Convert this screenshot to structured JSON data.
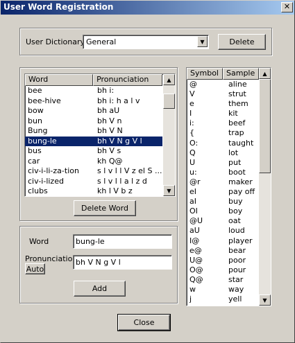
{
  "window": {
    "title": "User Word Registration",
    "close_glyph": "✕"
  },
  "dictionary": {
    "label": "User Dictionary",
    "selected": "General",
    "delete_label": "Delete"
  },
  "word_list": {
    "columns": [
      "Word",
      "Pronunciation"
    ],
    "rows": [
      {
        "word": "bee",
        "pron": "bh i:"
      },
      {
        "word": "bee-hive",
        "pron": "bh i: h a l v"
      },
      {
        "word": "bow",
        "pron": "bh aU"
      },
      {
        "word": "bun",
        "pron": "bh V n"
      },
      {
        "word": "Bung",
        "pron": "bh V N"
      },
      {
        "word": "bung-le",
        "pron": "bh V N g V l"
      },
      {
        "word": "bus",
        "pron": "bh V s"
      },
      {
        "word": "car",
        "pron": "kh Q@"
      },
      {
        "word": "civ-i-li-za-tion",
        "pron": "s l v l l V z el S ..."
      },
      {
        "word": "civ-i-lized",
        "pron": "s l v l l a l z d"
      },
      {
        "word": "clubs",
        "pron": "kh l V b z"
      }
    ],
    "selected_index": 5,
    "delete_word_label": "Delete Word"
  },
  "entry": {
    "word_label": "Word",
    "word_value": "bung-le",
    "pron_label": "Pronunciation",
    "auto_label": "Auto",
    "pron_value": "bh V N g V l",
    "add_label": "Add"
  },
  "symbols": {
    "columns": [
      "Symbol",
      "Sample"
    ],
    "rows": [
      {
        "sym": "@",
        "sample": "aline"
      },
      {
        "sym": "V",
        "sample": "strut"
      },
      {
        "sym": "e",
        "sample": "them"
      },
      {
        "sym": "I",
        "sample": "kit"
      },
      {
        "sym": "i:",
        "sample": "beef"
      },
      {
        "sym": "{",
        "sample": "trap"
      },
      {
        "sym": "O:",
        "sample": "taught"
      },
      {
        "sym": "Q",
        "sample": "lot"
      },
      {
        "sym": "U",
        "sample": "put"
      },
      {
        "sym": "u:",
        "sample": "boot"
      },
      {
        "sym": "@r",
        "sample": "maker"
      },
      {
        "sym": "eI",
        "sample": "pay off"
      },
      {
        "sym": "aI",
        "sample": "buy"
      },
      {
        "sym": "OI",
        "sample": "boy"
      },
      {
        "sym": "@U",
        "sample": "oat"
      },
      {
        "sym": "aU",
        "sample": "loud"
      },
      {
        "sym": "I@",
        "sample": "player"
      },
      {
        "sym": "e@",
        "sample": "bear"
      },
      {
        "sym": "U@",
        "sample": "poor"
      },
      {
        "sym": "O@",
        "sample": "pour"
      },
      {
        "sym": "Q@",
        "sample": "star"
      },
      {
        "sym": "w",
        "sample": "way"
      },
      {
        "sym": "j",
        "sample": "yell"
      }
    ]
  },
  "footer": {
    "close_label": "Close"
  },
  "colors": {
    "titlebar": "#0a246a",
    "selection": "#0a246a",
    "face": "#d4d0c8"
  }
}
